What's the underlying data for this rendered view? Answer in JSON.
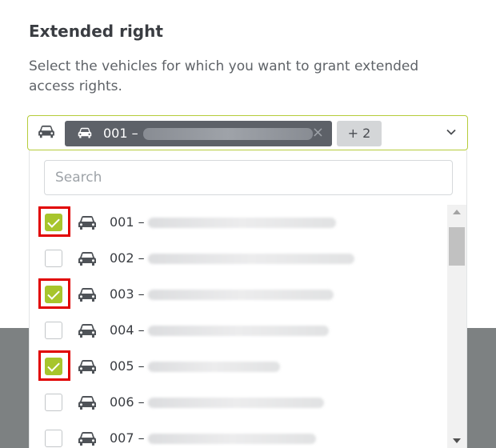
{
  "dialog": {
    "title": "Extended right",
    "description": "Select the vehicles for which you want to grant extended access rights."
  },
  "select": {
    "chip_label": "001 –",
    "more_label": "+ 2",
    "remove_symbol": "×"
  },
  "search": {
    "placeholder": "Search",
    "value": ""
  },
  "vehicles": [
    {
      "label": "001 –",
      "checked": true
    },
    {
      "label": "002 –",
      "checked": false
    },
    {
      "label": "003 –",
      "checked": true
    },
    {
      "label": "004 –",
      "checked": false
    },
    {
      "label": "005 –",
      "checked": true
    },
    {
      "label": "006 –",
      "checked": false
    },
    {
      "label": "007 –",
      "checked": false
    }
  ],
  "colors": {
    "accent": "#a7c52c",
    "highlight": "#e10000",
    "chip": "#5d6168"
  },
  "icons": {
    "vehicle": "car-icon",
    "dropdown": "chevron-down-icon",
    "remove": "close-icon"
  }
}
